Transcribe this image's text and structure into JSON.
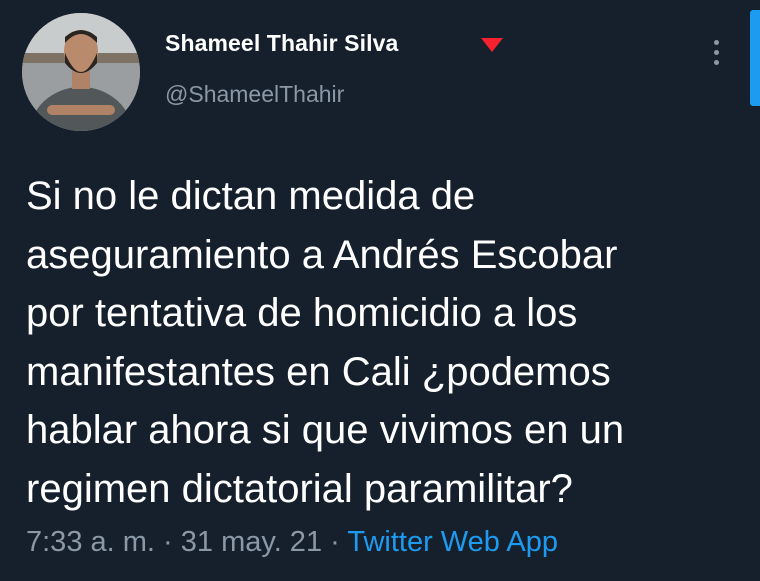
{
  "author": {
    "display_name": "Shameel Thahir Silva",
    "handle": "@ShameelThahir",
    "flag_icon": "red-triangle-down-icon",
    "avatar_icon": "profile-photo-avatar"
  },
  "menu": {
    "more_icon": "vertical-ellipsis-icon"
  },
  "tweet": {
    "lines": [
      "Si no le dictan medida de",
      "aseguramiento a Andrés Escobar",
      "por tentativa de homicidio a los",
      "manifestantes en Cali ¿podemos",
      "hablar ahora si que vivimos en un",
      "regimen dictatorial paramilitar?"
    ]
  },
  "meta": {
    "time": "7:33 a. m.",
    "separator": " · ",
    "date": "31 may. 21",
    "source": "Twitter Web App"
  },
  "colors": {
    "background": "#16202c",
    "text": "#ffffff",
    "muted": "#8b98a5",
    "link": "#1d9bf0",
    "flag": "#f4212e"
  }
}
